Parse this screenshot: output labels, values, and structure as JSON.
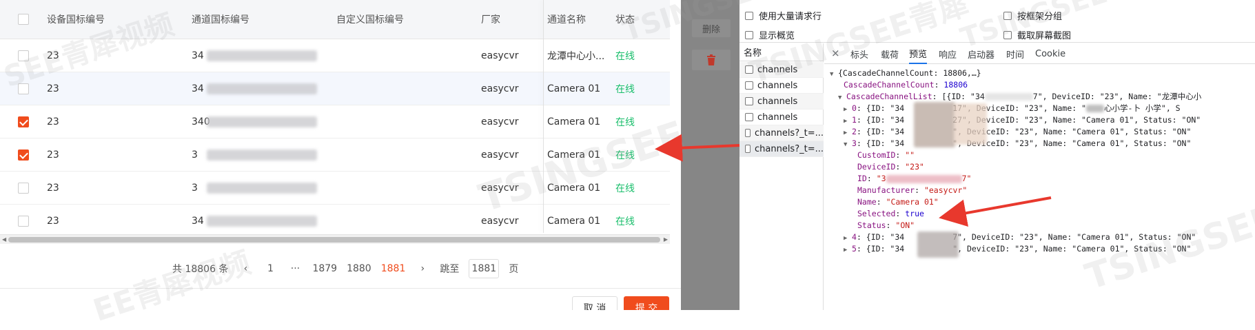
{
  "table": {
    "headers": [
      "设备国标编号",
      "通道国标编号",
      "自定义国标编号",
      "厂家",
      "通道名称",
      "状态"
    ],
    "rows": [
      {
        "device": "23",
        "channel": "34",
        "manufacturer": "easycvr",
        "name": "龙潭中心小...",
        "status": "在线",
        "checked": false
      },
      {
        "device": "23",
        "channel": "34",
        "manufacturer": "easycvr",
        "name": "Camera 01",
        "status": "在线",
        "checked": false
      },
      {
        "device": "23",
        "channel": "340",
        "manufacturer": "easycvr",
        "name": "Camera 01",
        "status": "在线",
        "checked": true
      },
      {
        "device": "23",
        "channel": "3",
        "manufacturer": "easycvr",
        "name": "Camera 01",
        "status": "在线",
        "checked": true
      },
      {
        "device": "23",
        "channel": "3",
        "manufacturer": "easycvr",
        "name": "Camera 01",
        "status": "在线",
        "checked": false
      },
      {
        "device": "23",
        "channel": "34",
        "manufacturer": "easycvr",
        "name": "Camera 01",
        "status": "在线",
        "checked": false
      }
    ]
  },
  "pagination": {
    "total": "共 18806 条",
    "prev": "‹",
    "page_first": "1",
    "ellipsis": "···",
    "pages": [
      "1879",
      "1880",
      "1881"
    ],
    "current": "1881",
    "next": "›",
    "jump_label": "跳至",
    "jump_value": "1881",
    "jump_unit": "页"
  },
  "footer": {
    "cancel": "取 消",
    "submit": "提 交"
  },
  "mid_panel": {
    "delete_label": "删除"
  },
  "devtools": {
    "options": {
      "large_rows": "使用大量请求行",
      "group_by_frame": "按框架分组",
      "show_overview": "显示概览",
      "capture_screenshots": "截取屏幕截图"
    },
    "name_header": "名称",
    "requests": [
      "channels",
      "channels",
      "channels",
      "channels",
      "channels?_t=...",
      "channels?_t=..."
    ],
    "close_icon": "×",
    "tabs": [
      "标头",
      "载荷",
      "预览",
      "响应",
      "启动器",
      "时间",
      "Cookie"
    ],
    "active_tab": "预览",
    "json": {
      "root": "{CascadeChannelCount: 18806,…}",
      "count_key": "CascadeChannelCount",
      "count_val": "18806",
      "list_key": "CascadeChannelList",
      "list_summary": "[{ID: \"34",
      "list_summary_tail": "7\", DeviceID: \"23\", Name: \"龙潭中心小",
      "items": [
        {
          "idx": "0",
          "pre": "{ID: \"34",
          "post": "17\", DeviceID: \"23\", Name: \"",
          "post2": "心小学-卜 小学\", S"
        },
        {
          "idx": "1",
          "pre": "{ID: \"34",
          "post": "27\", DeviceID: \"23\", Name: \"Camera 01\", Status: \"ON\""
        },
        {
          "idx": "2",
          "pre": "{ID: \"34",
          "post": "\", DeviceID: \"23\", Name: \"Camera 01\", Status: \"ON\""
        },
        {
          "idx": "3",
          "pre": "{ID: \"34",
          "post": "\", DeviceID: \"23\", Name: \"Camera 01\", Status: \"ON\""
        }
      ],
      "expanded": {
        "custom_id_key": "CustomID",
        "custom_id_val": "\"\"",
        "device_id_key": "DeviceID",
        "device_id_val": "\"23\"",
        "id_key": "ID",
        "id_val_pre": "\"3",
        "id_val_post": "7\"",
        "manufacturer_key": "Manufacturer",
        "manufacturer_val": "\"easycvr\"",
        "name_key": "Name",
        "name_val": "\"Camera 01\"",
        "selected_key": "Selected",
        "selected_val": "true",
        "status_key": "Status",
        "status_val": "\"ON\""
      },
      "more": [
        {
          "idx": "4",
          "pre": "{ID: \"34",
          "post": "7\", DeviceID: \"23\", Name: \"Camera 01\", Status: \"ON\""
        },
        {
          "idx": "5",
          "pre": "{ID: \"34",
          "post": "\", DeviceID: \"23\", Name: \"Camera 01\", Status: \"ON\""
        }
      ]
    }
  },
  "watermarks": [
    "SEE青犀视频",
    "TSINGSEE",
    "TSINGSEE青犀",
    "TSINGSEE",
    "TSINGSEE",
    "TSINGSEE",
    "EE青犀视频"
  ],
  "colors": {
    "accent": "#f04c1d",
    "online": "#19be6b",
    "arrow": "#e8382d",
    "devtools_tab": "#1a73e8"
  }
}
